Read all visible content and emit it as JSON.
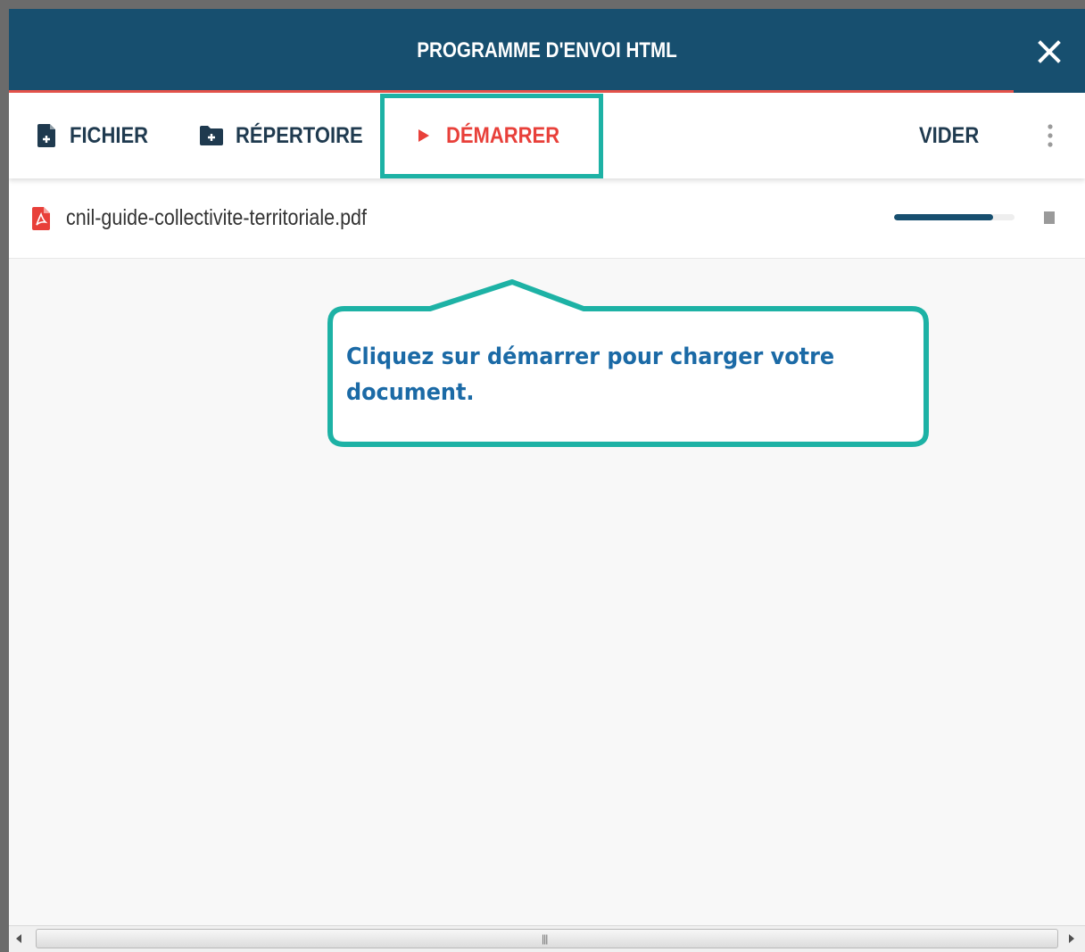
{
  "dialog": {
    "title": "PROGRAMME D'ENVOI HTML",
    "close_icon": "close-icon"
  },
  "toolbar": {
    "file_label": "FICHIER",
    "file_icon": "file-add-icon",
    "directory_label": "RÉPERTOIRE",
    "directory_icon": "folder-add-icon",
    "start_label": "DÉMARRER",
    "start_icon": "play-icon",
    "clear_label": "VIDER",
    "more_icon": "more-vertical-icon"
  },
  "files": [
    {
      "name": "cnil-guide-collectivite-territoriale.pdf",
      "icon": "pdf-icon",
      "progress_percent": 82
    }
  ],
  "callout": {
    "text": "Cliquez sur démarrer pour charger votre document."
  },
  "colors": {
    "header": "#174f6f",
    "accent_red": "#e8403a",
    "highlight_teal": "#1db2a5",
    "callout_text": "#1b6aa6"
  }
}
